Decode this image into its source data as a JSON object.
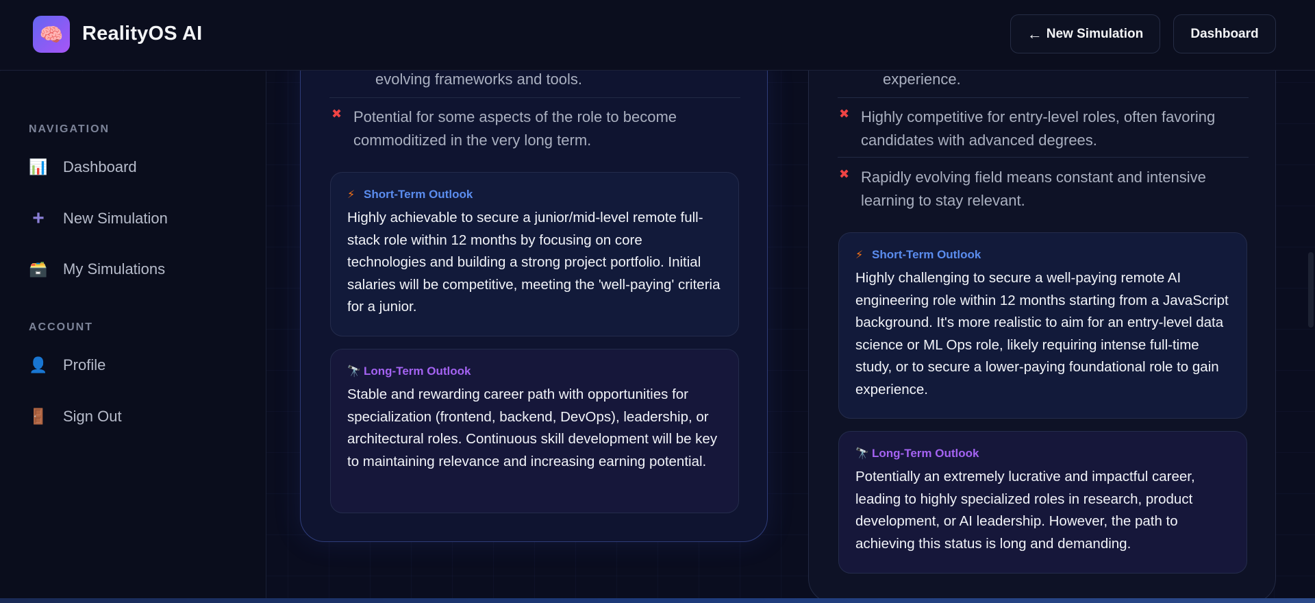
{
  "header": {
    "brand": "RealityOS AI",
    "logo_icon": "brain-icon",
    "new_simulation_label": "New Simulation",
    "dashboard_label": "Dashboard"
  },
  "sidebar": {
    "navigation_title": "NAVIGATION",
    "account_title": "ACCOUNT",
    "nav_items": [
      {
        "label": "Dashboard",
        "icon": "bar-chart-icon"
      },
      {
        "label": "New Simulation",
        "icon": "plus-icon"
      },
      {
        "label": "My Simulations",
        "icon": "card-box-icon"
      }
    ],
    "account_items": [
      {
        "label": "Profile",
        "icon": "user-icon"
      },
      {
        "label": "Sign Out",
        "icon": "door-icon"
      }
    ]
  },
  "left_card": {
    "partial_con": "evolving frameworks and tools.",
    "cons": [
      "Potential for some aspects of the role to become commoditized in the very long term."
    ],
    "short_term": {
      "title": "Short-Term Outlook",
      "text": "Highly achievable to secure a junior/mid-level remote full-stack role within 12 months by focusing on core technologies and building a strong project portfolio. Initial salaries will be competitive, meeting the 'well-paying' criteria for a junior."
    },
    "long_term": {
      "title": "Long-Term Outlook",
      "text": "Stable and rewarding career path with opportunities for specialization (frontend, backend, DevOps), leadership, or architectural roles. Continuous skill development will be key to maintaining relevance and increasing earning potential."
    }
  },
  "right_card": {
    "partial_con": "experience.",
    "cons": [
      "Highly competitive for entry-level roles, often favoring candidates with advanced degrees.",
      "Rapidly evolving field means constant and intensive learning to stay relevant."
    ],
    "short_term": {
      "title": "Short-Term Outlook",
      "text": "Highly challenging to secure a well-paying remote AI engineering role within 12 months starting from a JavaScript background. It's more realistic to aim for an entry-level data science or ML Ops role, likely requiring intense full-time study, or to secure a lower-paying foundational role to gain experience."
    },
    "long_term": {
      "title": "Long-Term Outlook",
      "text": "Potentially an extremely lucrative and impactful career, leading to highly specialized roles in research, product development, or AI leadership. However, the path to achieving this status is long and demanding."
    }
  },
  "colors": {
    "background": "#0a0d1f",
    "short_term_accent": "#5b8def",
    "long_term_accent": "#a463f2",
    "con_marker": "#ef4444",
    "logo_gradient_start": "#6366f1",
    "logo_gradient_end": "#a855f7"
  }
}
